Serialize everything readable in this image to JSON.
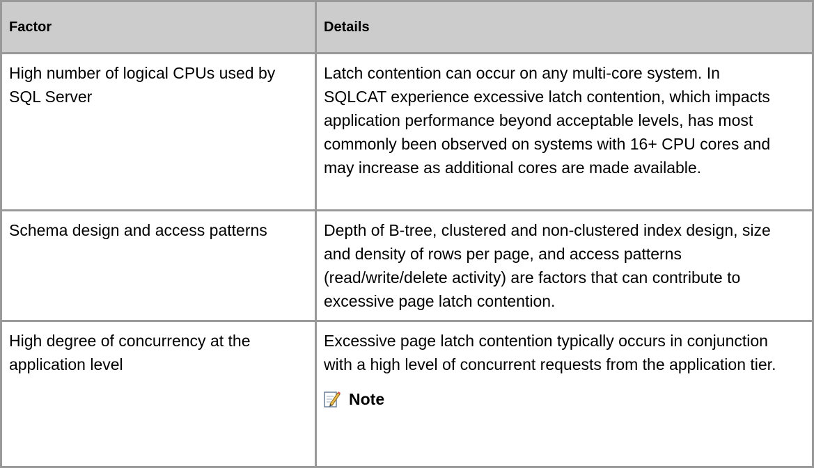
{
  "table": {
    "headers": {
      "factor": "Factor",
      "details": "Details"
    },
    "rows": [
      {
        "factor": "High number of logical CPUs used by SQL Server",
        "details": "Latch contention can occur on any multi-core system. In SQLCAT experience excessive latch contention, which impacts application performance beyond acceptable levels, has most commonly been observed on systems with 16+ CPU cores and may increase as additional cores are made available."
      },
      {
        "factor": "Schema design and access patterns",
        "details": "Depth of B-tree, clustered and non-clustered index design, size and density of rows per page, and access patterns (read/write/delete activity) are factors that can contribute to excessive page latch contention."
      },
      {
        "factor": "High degree of concurrency at the application level",
        "details": "Excessive page latch contention typically occurs in conjunction with a high level of concurrent requests from the application tier.",
        "note_label": "Note",
        "note_icon": "note-pencil-icon"
      }
    ]
  }
}
